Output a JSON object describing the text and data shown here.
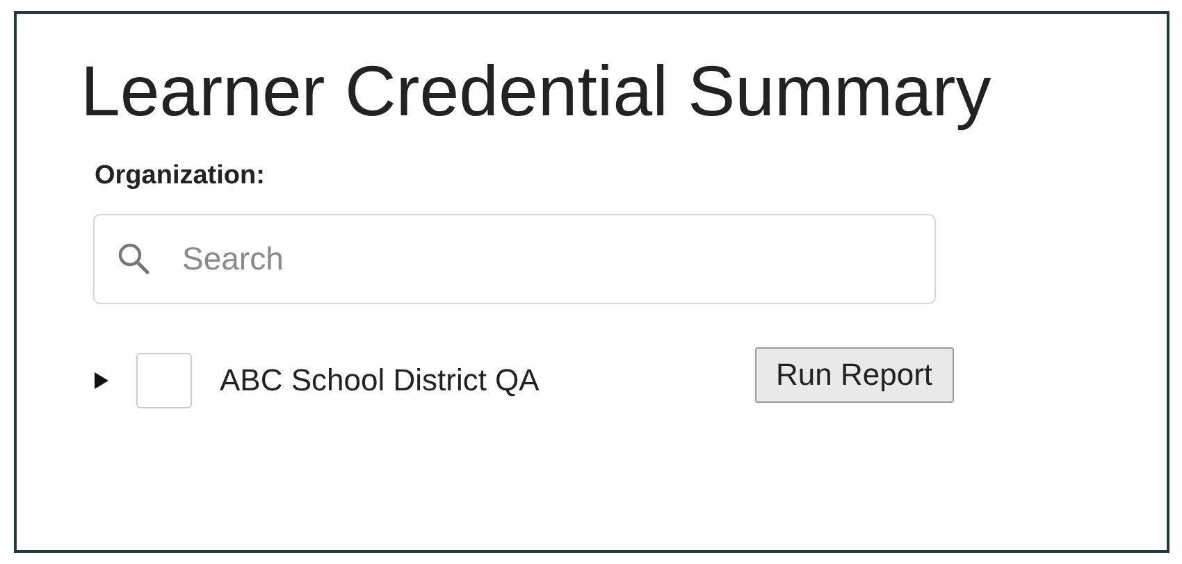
{
  "title": "Learner Credential Summary",
  "organization": {
    "label": "Organization:",
    "search": {
      "placeholder": "Search"
    },
    "tree": [
      {
        "label": "ABC School District QA",
        "expanded": false,
        "checked": false
      }
    ]
  },
  "buttons": [
    "Run Report"
  ]
}
